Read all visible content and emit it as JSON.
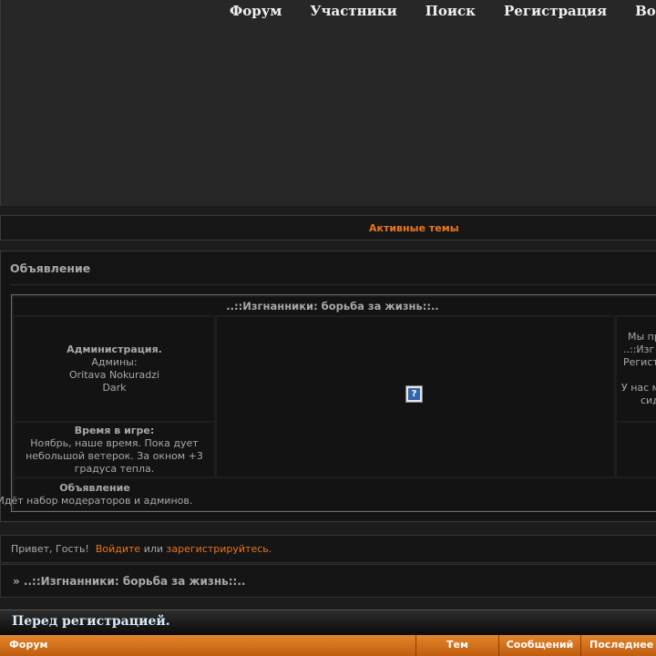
{
  "nav": [
    "Форум",
    "Участники",
    "Поиск",
    "Регистрация",
    "Войти"
  ],
  "active_topics": "Активные темы",
  "announcement": {
    "title": "Объявление",
    "forum_name": "..::Изгнанники: борьба за жизнь::..",
    "admin_heading": "Администрация.",
    "admins_label": "Админы:",
    "admin_1": "Oritava Nokuradzi",
    "admin_2": "Dark",
    "time_heading": "Время в игре:",
    "time_text": "Ноябрь, наше время. Пока дует небольшой ветерок. За окном +3 градуса тепла.",
    "right_lines": [
      "Мы пр",
      "..::Изг",
      "Регист",
      "",
      "У нас м",
      "сид"
    ],
    "bottom_heading": "Объявление",
    "bottom_text": "Идёт набор модераторов и админов."
  },
  "greeting": {
    "hello": "Привет, Гость!",
    "login": "Войдите",
    "or": "или",
    "register": "зарегистрируйтесь."
  },
  "breadcrumb": "» ..::Изгнанники: борьба за жизнь::..",
  "category": "Перед регистрацией.",
  "table_headers": {
    "forum": "Форум",
    "topics": "Тем",
    "posts": "Сообщений",
    "last": "Последнее с"
  },
  "colors": {
    "accent": "#e8761f",
    "background": "#1c1c1c"
  }
}
